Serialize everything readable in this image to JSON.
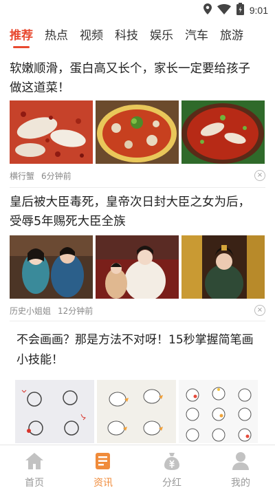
{
  "status_bar": {
    "time": "9:01",
    "icons": [
      "location-icon",
      "wifi-icon",
      "battery-icon"
    ]
  },
  "tabs": [
    {
      "label": "推荐",
      "active": true
    },
    {
      "label": "热点"
    },
    {
      "label": "视频"
    },
    {
      "label": "科技"
    },
    {
      "label": "娱乐"
    },
    {
      "label": "汽车"
    },
    {
      "label": "旅游"
    }
  ],
  "articles": [
    {
      "title": "软嫩顺滑，蛋白高又长个，家长一定要给孩子做这道菜！",
      "source": "横行蟹",
      "time": "6分钟前",
      "close": "×"
    },
    {
      "title": "皇后被大臣毒死，皇帝次日封大臣之女为后，受辱5年赐死大臣全族",
      "source": "历史小姐姐",
      "time": "12分钟前",
      "close": "×"
    },
    {
      "title": "不会画画？那是方法不对呀！15秒掌握简笔画小技能！"
    }
  ],
  "bottom_nav": [
    {
      "label": "首页",
      "icon": "home-icon"
    },
    {
      "label": "资讯",
      "icon": "news-icon",
      "active": true
    },
    {
      "label": "分红",
      "icon": "money-bag-icon"
    },
    {
      "label": "我的",
      "icon": "user-icon"
    }
  ],
  "colors": {
    "accent": "#e8492f",
    "nav_active": "#f08b3a",
    "nav_inactive": "#bbbbbb"
  }
}
